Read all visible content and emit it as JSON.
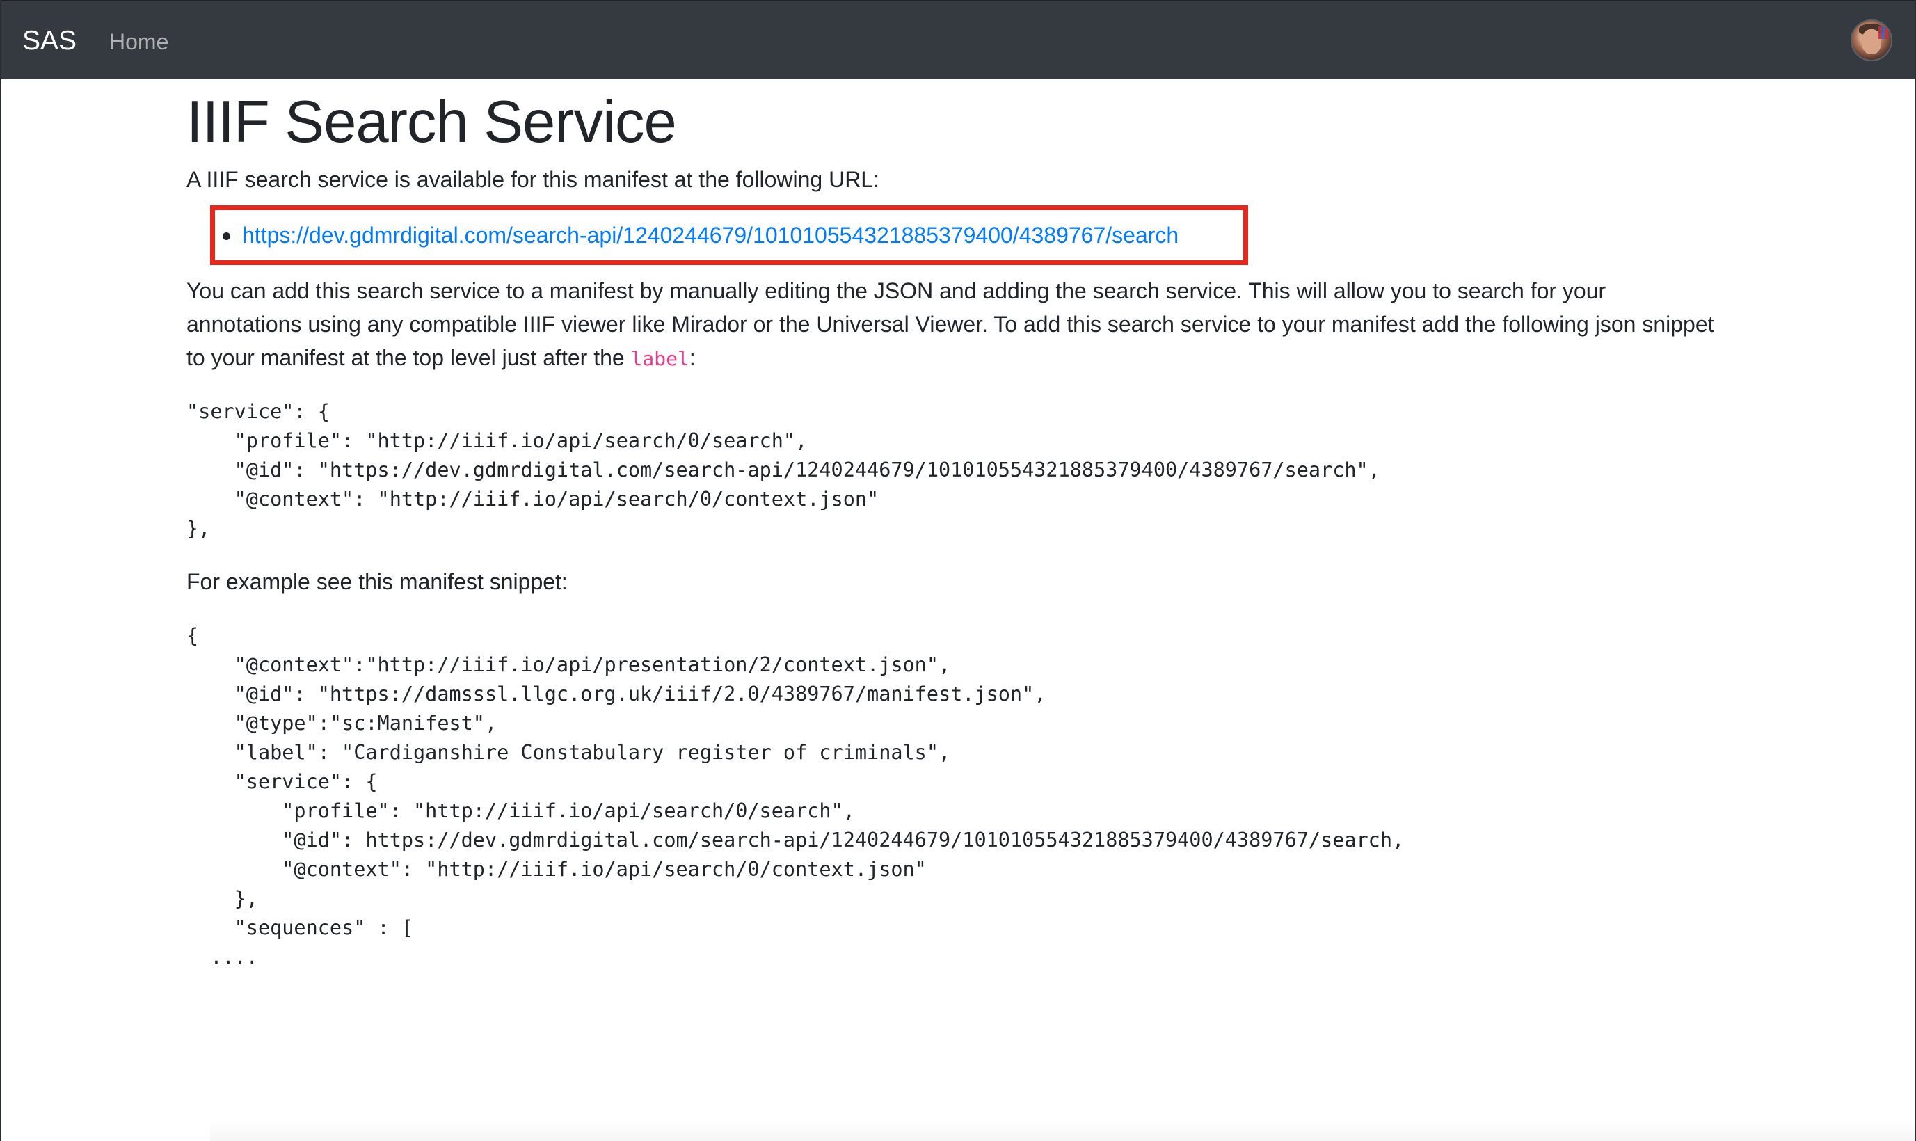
{
  "navbar": {
    "brand": "SAS",
    "home_label": "Home",
    "avatar_icon": "user-avatar-icon"
  },
  "page": {
    "title": "IIIF Search Service",
    "intro": "A IIIF search service is available for this manifest at the following URL:",
    "search_url": "https://dev.gdmrdigital.com/search-api/1240244679/101010554321885379400/4389767/search",
    "highlight_color": "#e8271c",
    "description_before": "You can add this search service to a manifest by manually editing the JSON and adding the search service. This will allow you to search for your annotations using any compatible IIIF viewer like Mirador or the Universal Viewer. To add this search service to your manifest add the following json snippet to your manifest at the top level just after the ",
    "description_code": "label",
    "description_after": ":",
    "service_snippet": "\"service\": {\n    \"profile\": \"http://iiif.io/api/search/0/search\",\n    \"@id\": \"https://dev.gdmrdigital.com/search-api/1240244679/101010554321885379400/4389767/search\",\n    \"@context\": \"http://iiif.io/api/search/0/context.json\"\n},",
    "example_intro": "For example see this manifest snippet:",
    "manifest_snippet": "{\n    \"@context\":\"http://iiif.io/api/presentation/2/context.json\",\n    \"@id\": \"https://damsssl.llgc.org.uk/iiif/2.0/4389767/manifest.json\",\n    \"@type\":\"sc:Manifest\",\n    \"label\": \"Cardiganshire Constabulary register of criminals\",\n    \"service\": {\n        \"profile\": \"http://iiif.io/api/search/0/search\",\n        \"@id\": https://dev.gdmrdigital.com/search-api/1240244679/101010554321885379400/4389767/search,\n        \"@context\": \"http://iiif.io/api/search/0/context.json\"\n    },\n    \"sequences\" : [\n  ...."
  },
  "colors": {
    "navbar_bg": "#343a40",
    "link": "#007bff",
    "inline_code": "#e83e8c"
  }
}
